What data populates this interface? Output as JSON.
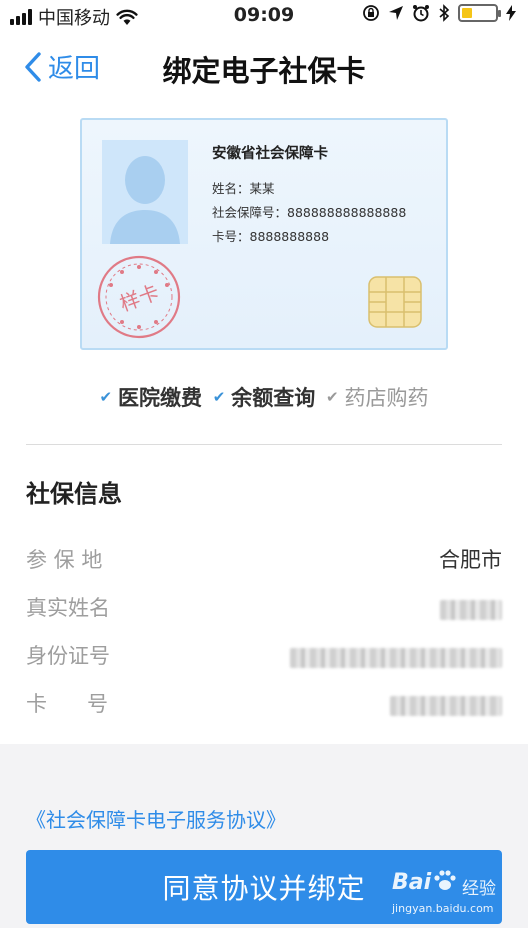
{
  "status_bar": {
    "carrier": "中国移动",
    "time": "09:09",
    "battery_level": 0.32,
    "battery_color": "#f5c518",
    "icons": [
      "signal-icon",
      "wifi-icon",
      "rotation-lock-icon",
      "location-icon",
      "alarm-icon",
      "bluetooth-icon",
      "battery-icon",
      "charging-icon"
    ]
  },
  "nav": {
    "back_label": "返回",
    "title": "绑定电子社保卡"
  },
  "card": {
    "title": "安徽省社会保障卡",
    "name_line": "姓名：某某",
    "ssn_line": "社会保障号：888888888888888",
    "card_no_line": "卡号：8888888888",
    "stamp_text": "样卡"
  },
  "features": [
    {
      "label": "医院缴费",
      "enabled": true
    },
    {
      "label": "余额查询",
      "enabled": true
    },
    {
      "label": "药店购药",
      "enabled": false
    }
  ],
  "info": {
    "title": "社保信息",
    "rows": [
      {
        "key": "参 保 地",
        "value": "合肥市"
      },
      {
        "key": "真实姓名",
        "value": ""
      },
      {
        "key": "身份证号",
        "value": ""
      },
      {
        "key": "卡      号",
        "value": ""
      }
    ]
  },
  "agreement_link": "《社会保障卡电子服务协议》",
  "bind_button": "同意协议并绑定",
  "watermark": {
    "logo": "Bai",
    "text": "经验",
    "url": "jingyan.baidu.com"
  },
  "colors": {
    "accent": "#2f8ce8",
    "card_bg": "#eaf4fc",
    "stamp": "#e07a86"
  }
}
